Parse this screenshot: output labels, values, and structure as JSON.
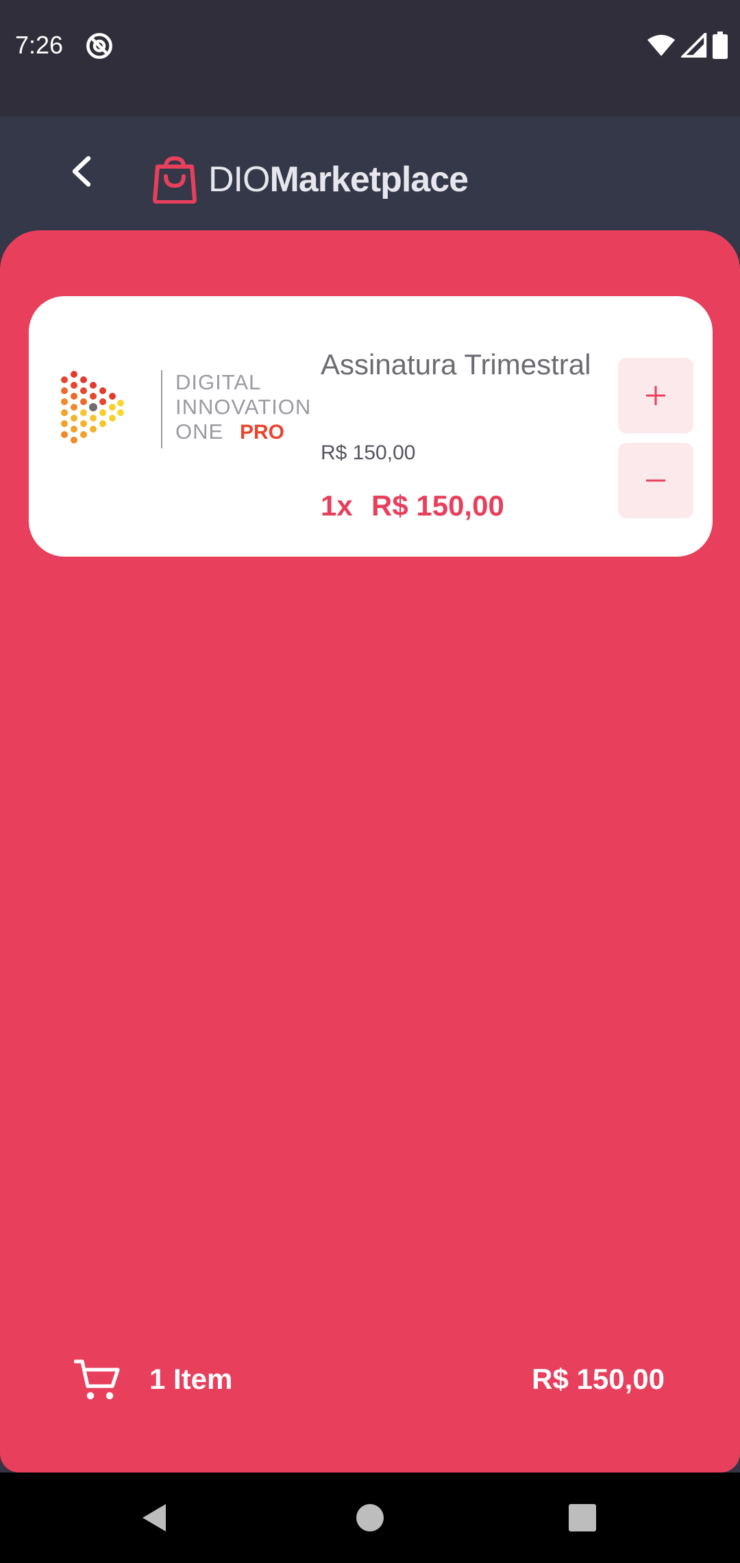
{
  "status_bar": {
    "time": "7:26",
    "icons": [
      "at-sign-icon",
      "wifi-icon",
      "signal-icon",
      "battery-icon"
    ]
  },
  "app_bar": {
    "back_icon": "chevron-left-icon",
    "logo": {
      "icon": "shopping-bag-icon",
      "text_light": "DIO",
      "text_bold": "Marketplace"
    }
  },
  "cart": {
    "items": [
      {
        "image": {
          "brand_lines": [
            "DIGITAL",
            "INNOVATION",
            "ONE"
          ],
          "brand_badge": "PRO"
        },
        "name": "Assinatura Trimestral",
        "unit_price": "R$ 150,00",
        "quantity_label": "1x",
        "line_total": "R$ 150,00",
        "increment_icon": "plus-icon",
        "decrement_icon": "minus-icon"
      }
    ],
    "summary": {
      "icon": "shopping-cart-icon",
      "count_label": "1 Item",
      "total": "R$ 150,00"
    }
  },
  "nav_bar": {
    "icons": [
      "triangle-back-icon",
      "circle-home-icon",
      "square-recents-icon"
    ]
  },
  "colors": {
    "accent": "#E8405C",
    "app_bar": "#343848",
    "status_bar": "#2F2E3A",
    "card": "#FFFFFF",
    "qty_button": "#FCE9EC"
  }
}
